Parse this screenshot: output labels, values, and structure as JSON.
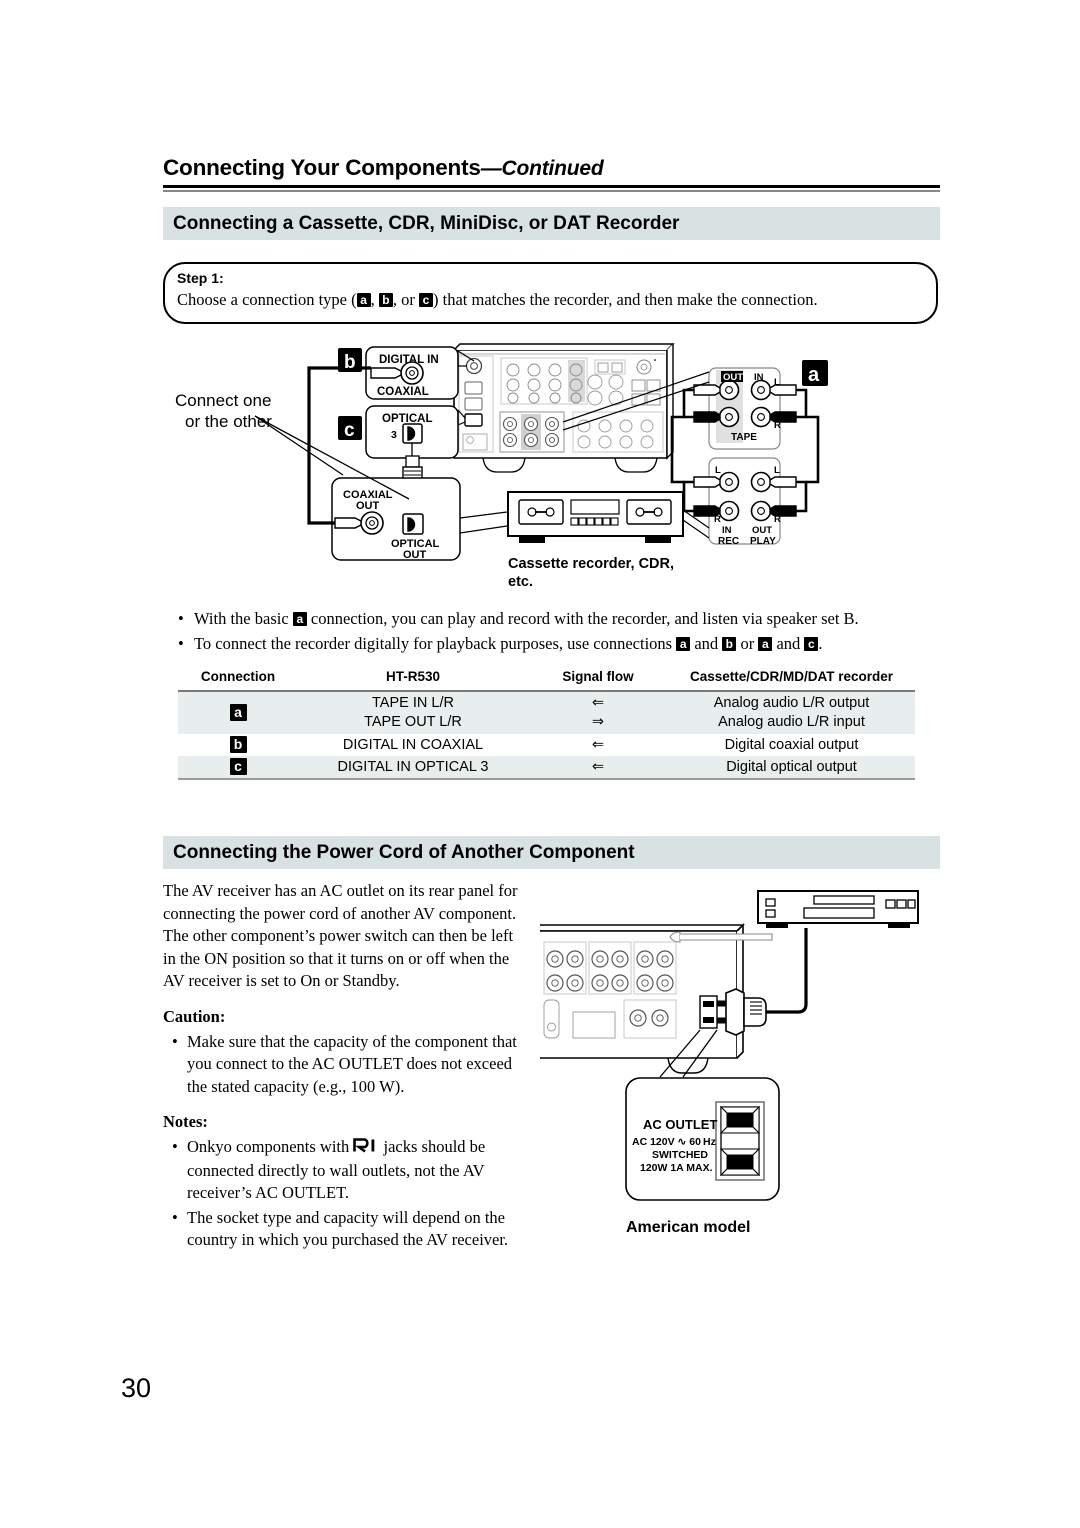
{
  "page": {
    "number": "30",
    "running_head_main": "Connecting Your Components",
    "running_head_cont": "—Continued"
  },
  "section_cassette": {
    "band_title": "Connecting a Cassette, CDR, MiniDisc, or DAT Recorder",
    "step": {
      "label": "Step 1:",
      "text_before": "Choose a connection type (",
      "badge_a": "a",
      "sep1": ", ",
      "badge_b": "b",
      "sep2": ", or ",
      "badge_c": "c",
      "text_after": ") that matches the recorder, and then make the connection."
    },
    "bullets": [
      {
        "before": "With the basic ",
        "badge1": "a",
        "after": " connection, you can play and record with the recorder, and listen via speaker set B."
      },
      {
        "before": "To connect the recorder digitally for playback purposes, use connections ",
        "badge1": "a",
        "mid1": " and ",
        "badge2": "b",
        "mid2": " or ",
        "badge3": "a",
        "mid3": " and ",
        "badge4": "c",
        "after": "."
      }
    ],
    "table": {
      "headers": [
        "Connection",
        "HT-R530",
        "Signal flow",
        "Cassette/CDR/MD/DAT recorder"
      ],
      "rows": [
        {
          "connection": "a",
          "receiver": [
            "TAPE IN L/R",
            "TAPE OUT L/R"
          ],
          "flow": [
            "⇐",
            "⇒"
          ],
          "recorder": [
            "Analog audio L/R output",
            "Analog audio L/R input"
          ]
        },
        {
          "connection": "b",
          "receiver": [
            "DIGITAL IN COAXIAL"
          ],
          "flow": [
            "⇐"
          ],
          "recorder": [
            "Digital coaxial output"
          ]
        },
        {
          "connection": "c",
          "receiver": [
            "DIGITAL IN OPTICAL 3"
          ],
          "flow": [
            "⇐"
          ],
          "recorder": [
            "Digital optical output"
          ]
        }
      ]
    },
    "figure": {
      "connect_one": "Connect one",
      "or_other": "or the other",
      "badge_a": "a",
      "badge_b": "b",
      "badge_c": "c",
      "digital_in": "DIGITAL IN",
      "coaxial": "COAXIAL",
      "optical": "OPTICAL",
      "optical_num": "3",
      "coaxial_out_1": "COAXIAL",
      "coaxial_out_2": "OUT",
      "optical_out_1": "OPTICAL",
      "optical_out_2": "OUT",
      "tape_out": "OUT",
      "tape_in": "IN",
      "tape_label": "TAPE",
      "tape_L": "L",
      "tape_R": "R",
      "rec_L": "L",
      "rec_R": "R",
      "play_L": "L",
      "play_R": "R",
      "rec_in": "IN",
      "play_out": "OUT",
      "rec": "REC",
      "play": "PLAY",
      "caption_1": "Cassette recorder, CDR,",
      "caption_2": "etc."
    }
  },
  "section_power": {
    "band_title": "Connecting the Power Cord of Another Component",
    "body": "The AV receiver has an AC outlet on its rear panel for connecting the power cord of another AV component. The other component’s power switch can then be left in the ON position so that it turns on or off when the AV receiver is set to On or Standby.",
    "caution_head": "Caution:",
    "caution_items": [
      "Make sure that the capacity of the component that you connect to the AC OUTLET does not exceed the stated capacity (e.g., 100 W)."
    ],
    "notes_head": "Notes:",
    "notes_items": [
      {
        "before": "Onkyo components with ",
        "icon": "ri-logo-icon",
        "after": " jacks should be connected directly to wall outlets, not the AV receiver’s AC OUTLET."
      },
      {
        "before": "The socket type and capacity will depend on the country in which you purchased the AV receiver.",
        "icon": "",
        "after": ""
      }
    ],
    "figure": {
      "ac_outlet_title": "AC OUTLET",
      "ac_line1": "AC 120V  ∿   60 Hz",
      "ac_line2": "SWITCHED",
      "ac_line3": "120W  1A  MAX.",
      "model_caption": "American model"
    }
  },
  "colors": {
    "band": "#d8e2e2",
    "table_shade": "#e8eeee",
    "rule": "#000000",
    "rule_light": "#888888"
  }
}
